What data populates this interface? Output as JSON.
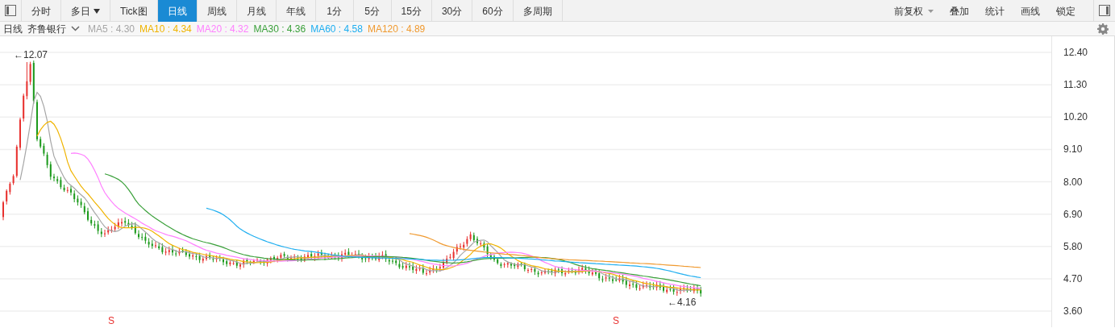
{
  "toolbar": {
    "tabs": [
      {
        "label": "分时",
        "selected": false,
        "dropdown": false
      },
      {
        "label": "多日",
        "selected": false,
        "dropdown": true
      },
      {
        "label": "Tick图",
        "selected": false,
        "dropdown": false
      },
      {
        "label": "日线",
        "selected": true,
        "dropdown": false
      },
      {
        "label": "周线",
        "selected": false,
        "dropdown": false
      },
      {
        "label": "月线",
        "selected": false,
        "dropdown": false
      },
      {
        "label": "年线",
        "selected": false,
        "dropdown": false
      },
      {
        "label": "1分",
        "selected": false,
        "dropdown": false
      },
      {
        "label": "5分",
        "selected": false,
        "dropdown": false
      },
      {
        "label": "15分",
        "selected": false,
        "dropdown": false
      },
      {
        "label": "30分",
        "selected": false,
        "dropdown": false
      },
      {
        "label": "60分",
        "selected": false,
        "dropdown": false
      },
      {
        "label": "多周期",
        "selected": false,
        "dropdown": false
      }
    ],
    "right_buttons": [
      {
        "label": "前复权",
        "dropdown": true
      },
      {
        "label": "叠加",
        "dropdown": false
      },
      {
        "label": "统计",
        "dropdown": false
      },
      {
        "label": "画线",
        "dropdown": false
      },
      {
        "label": "锁定",
        "dropdown": false
      }
    ]
  },
  "legend": {
    "period": "日线",
    "stock": "齐鲁银行",
    "moving_averages": [
      {
        "label": "MA5 : 4.30",
        "color": "#a6a6a6"
      },
      {
        "label": "MA10 : 4.34",
        "color": "#f0b400"
      },
      {
        "label": "MA20 : 4.32",
        "color": "#ff80ff"
      },
      {
        "label": "MA30 : 4.36",
        "color": "#3aa03a"
      },
      {
        "label": "MA60 : 4.58",
        "color": "#1eaef0"
      },
      {
        "label": "MA120 : 4.89",
        "color": "#f09a30"
      }
    ]
  },
  "chart": {
    "y_axis_labels": [
      "12.40",
      "11.30",
      "10.20",
      "9.10",
      "8.00",
      "6.90",
      "5.80",
      "4.70",
      "3.60"
    ],
    "high_marker": "←12.07",
    "low_marker": "←4.16",
    "signals": [
      "S",
      "S"
    ]
  }
}
